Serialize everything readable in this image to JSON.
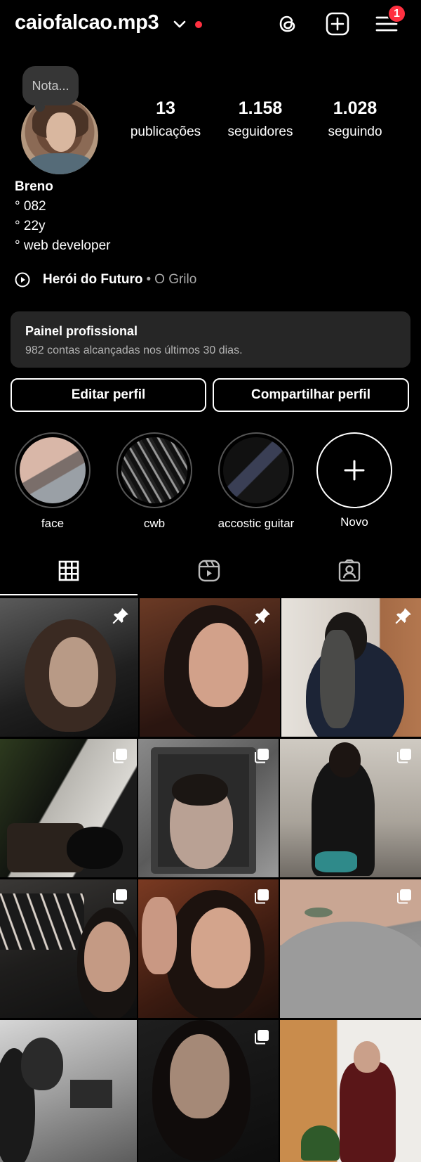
{
  "header": {
    "username": "caiofalcao.mp3",
    "notification_count": "1",
    "icons": [
      "chevron-down-icon",
      "threads-icon",
      "add-post-icon",
      "menu-icon"
    ]
  },
  "profile": {
    "note": "Nota...",
    "stats": {
      "posts": {
        "value": "13",
        "label": "publicações"
      },
      "followers": {
        "value": "1.158",
        "label": "seguidores"
      },
      "following": {
        "value": "1.028",
        "label": "seguindo"
      }
    },
    "bio": {
      "name": "Breno",
      "lines": [
        "° 082",
        "° 22y",
        "° web developer"
      ]
    },
    "music": {
      "song": "Herói do Futuro",
      "separator": "•",
      "artist": "O Grilo"
    },
    "professional_panel": {
      "title": "Painel profissional",
      "subtitle": "982 contas alcançadas nos últimos 30 dias."
    },
    "buttons": {
      "edit": "Editar perfil",
      "share": "Compartilhar perfil"
    }
  },
  "highlights": [
    {
      "label": "face"
    },
    {
      "label": "cwb"
    },
    {
      "label": "accostic guitar"
    },
    {
      "label": "Novo"
    }
  ],
  "tabs": [
    "grid-icon",
    "reels-icon",
    "tagged-icon"
  ],
  "posts": [
    {
      "badge": "pin-icon"
    },
    {
      "badge": "pin-icon"
    },
    {
      "badge": "pin-icon"
    },
    {
      "badge": "carousel-icon"
    },
    {
      "badge": "carousel-icon"
    },
    {
      "badge": "carousel-icon"
    },
    {
      "badge": "carousel-icon"
    },
    {
      "badge": "carousel-icon"
    },
    {
      "badge": "carousel-icon"
    },
    {
      "badge": ""
    },
    {
      "badge": "carousel-icon"
    },
    {
      "badge": ""
    }
  ],
  "colors": {
    "background": "#000000",
    "surface": "#262626",
    "notification_red": "#ff3040",
    "muted_text": "#a8a8a8"
  }
}
